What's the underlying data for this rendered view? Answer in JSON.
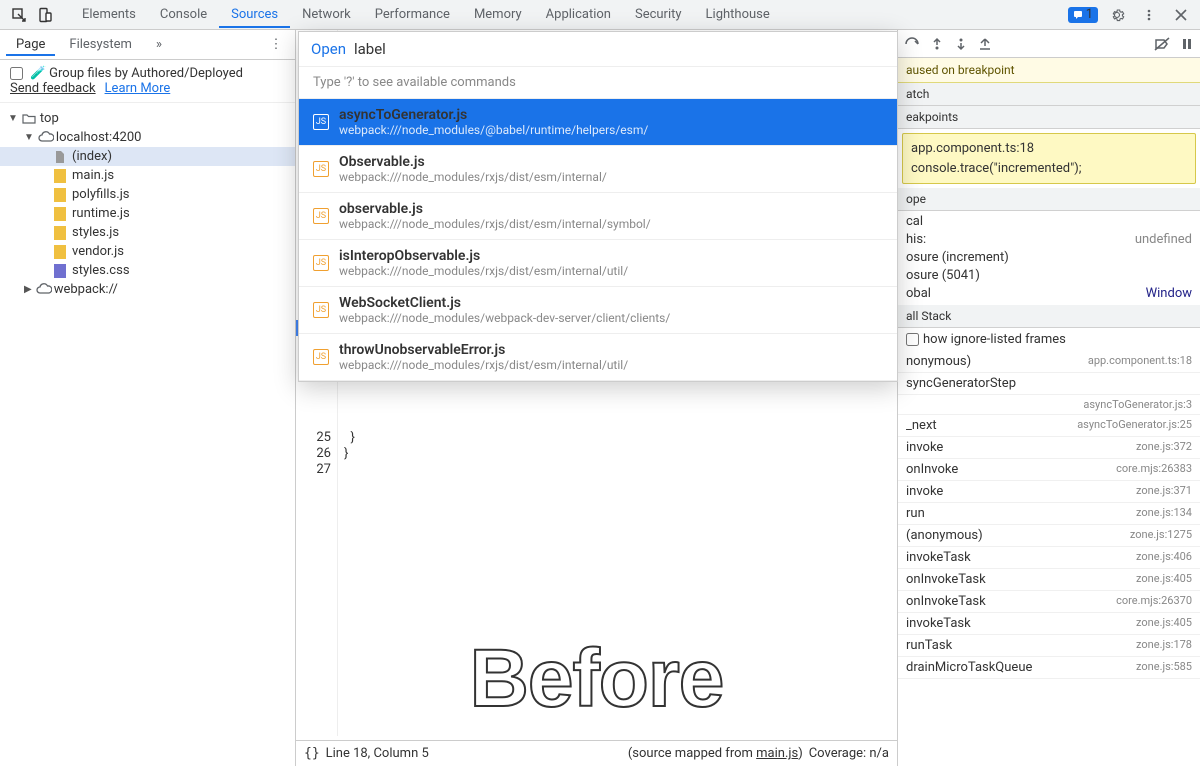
{
  "toolbar": {
    "tabs": [
      "Elements",
      "Console",
      "Sources",
      "Network",
      "Performance",
      "Memory",
      "Application",
      "Security",
      "Lighthouse"
    ],
    "active_tab": "Sources",
    "badge_count": "1"
  },
  "left": {
    "tabs": [
      "Page",
      "Filesystem"
    ],
    "active_tab": "Page",
    "authored_label": "Group files by Authored/Deployed",
    "feedback": "Send feedback",
    "learn_more": "Learn More",
    "tree": [
      {
        "depth": 0,
        "icon": "tri-down",
        "label": "top",
        "type": "folder-open"
      },
      {
        "depth": 1,
        "icon": "tri-down",
        "label": "localhost:4200",
        "type": "cloud"
      },
      {
        "depth": 2,
        "icon": "none",
        "label": "(index)",
        "type": "file",
        "sel": true
      },
      {
        "depth": 2,
        "icon": "none",
        "label": "main.js",
        "type": "js"
      },
      {
        "depth": 2,
        "icon": "none",
        "label": "polyfills.js",
        "type": "js"
      },
      {
        "depth": 2,
        "icon": "none",
        "label": "runtime.js",
        "type": "js"
      },
      {
        "depth": 2,
        "icon": "none",
        "label": "styles.js",
        "type": "js"
      },
      {
        "depth": 2,
        "icon": "none",
        "label": "vendor.js",
        "type": "js"
      },
      {
        "depth": 2,
        "icon": "none",
        "label": "styles.css",
        "type": "css"
      },
      {
        "depth": 1,
        "icon": "tri-right",
        "label": "webpack://",
        "type": "cloud"
      }
    ]
  },
  "center": {
    "gutter": [
      "25",
      "26",
      "27"
    ],
    "code_lines": [
      "  }",
      "}",
      ""
    ],
    "status_left": "Line 18, Column 5",
    "status_map": "(source mapped from ",
    "status_map_file": "main.js",
    "status_map_end": ")",
    "status_cov": "Coverage: n/a",
    "watermark": "Before"
  },
  "popup": {
    "command": "Open",
    "input_value": "label",
    "hint": "Type '?' to see available commands",
    "items": [
      {
        "name": "asyncToGenerator.js",
        "sub": "webpack:///node_modules/@babel/runtime/helpers/esm/",
        "sel": true
      },
      {
        "name": "Observable.js",
        "sub": "webpack:///node_modules/rxjs/dist/esm/internal/"
      },
      {
        "name": "observable.js",
        "sub": "webpack:///node_modules/rxjs/dist/esm/internal/symbol/"
      },
      {
        "name": "isInteropObservable.js",
        "sub": "webpack:///node_modules/rxjs/dist/esm/internal/util/"
      },
      {
        "name": "WebSocketClient.js",
        "sub": "webpack:///node_modules/webpack-dev-server/client/clients/"
      },
      {
        "name": "throwUnobservableError.js",
        "sub": "webpack:///node_modules/rxjs/dist/esm/internal/util/"
      }
    ]
  },
  "right": {
    "paused_msg": "aused on breakpoint",
    "sections": {
      "watch": "atch",
      "breakpoints": "eakpoints",
      "scope": "ope",
      "callstack": "all Stack"
    },
    "bp_file": "app.component.ts:18",
    "bp_code": "console.trace(\"incremented\");",
    "scope_lines": [
      {
        "l": "cal"
      },
      {
        "l": "his:",
        "v": "undefined"
      },
      {
        "l": "osure (increment)"
      },
      {
        "l": "osure (5041)"
      },
      {
        "l": "obal",
        "v": "Window",
        "w": true
      }
    ],
    "show_ignored": "how ignore-listed frames",
    "callstack": [
      {
        "fn": "nonymous)",
        "src": "app.component.ts:18"
      },
      {
        "fn": "syncGeneratorStep",
        "src": ""
      },
      {
        "fn": "",
        "src": "asyncToGenerator.js:3"
      },
      {
        "fn": "_next",
        "src": "asyncToGenerator.js:25"
      },
      {
        "fn": "invoke",
        "src": "zone.js:372"
      },
      {
        "fn": "onInvoke",
        "src": "core.mjs:26383"
      },
      {
        "fn": "invoke",
        "src": "zone.js:371"
      },
      {
        "fn": "run",
        "src": "zone.js:134"
      },
      {
        "fn": "(anonymous)",
        "src": "zone.js:1275"
      },
      {
        "fn": "invokeTask",
        "src": "zone.js:406"
      },
      {
        "fn": "onInvokeTask",
        "src": "zone.js:405"
      },
      {
        "fn": "onInvokeTask",
        "src": "core.mjs:26370"
      },
      {
        "fn": "invokeTask",
        "src": "zone.js:405"
      },
      {
        "fn": "runTask",
        "src": "zone.js:178"
      },
      {
        "fn": "drainMicroTaskQueue",
        "src": "zone.js:585"
      }
    ]
  }
}
